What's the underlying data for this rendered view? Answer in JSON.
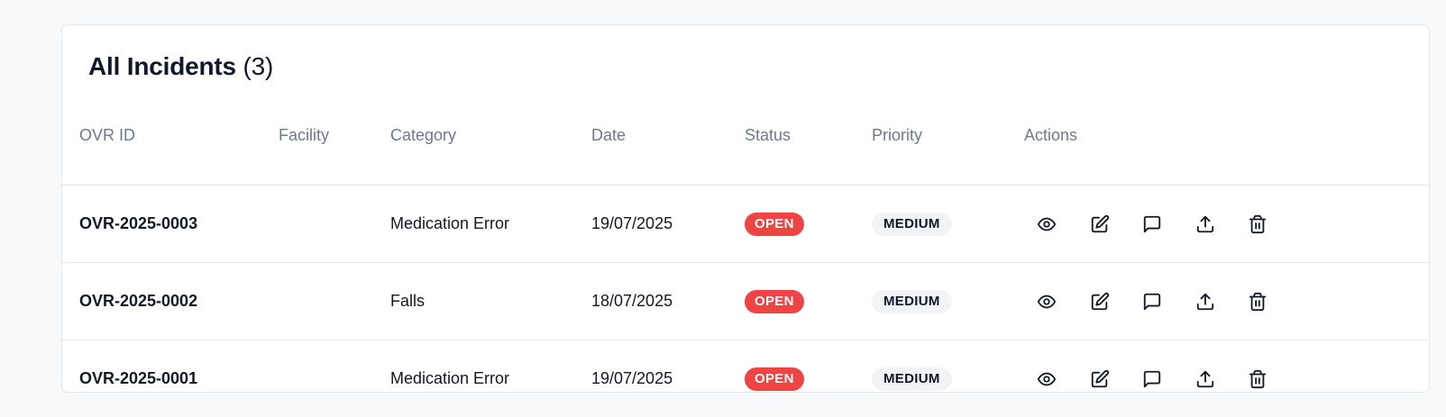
{
  "card": {
    "title": "All Incidents",
    "count": "(3)"
  },
  "columns": {
    "id": "OVR ID",
    "facility": "Facility",
    "category": "Category",
    "date": "Date",
    "status": "Status",
    "priority": "Priority",
    "actions": "Actions"
  },
  "rows": [
    {
      "id": "OVR-2025-0003",
      "facility": "",
      "category": "Medication Error",
      "date": "19/07/2025",
      "status": "OPEN",
      "priority": "MEDIUM"
    },
    {
      "id": "OVR-2025-0002",
      "facility": "",
      "category": "Falls",
      "date": "18/07/2025",
      "status": "OPEN",
      "priority": "MEDIUM"
    },
    {
      "id": "OVR-2025-0001",
      "facility": "",
      "category": "Medication Error",
      "date": "19/07/2025",
      "status": "OPEN",
      "priority": "MEDIUM"
    }
  ],
  "action_icons": [
    "eye-icon",
    "edit-icon",
    "comment-icon",
    "upload-icon",
    "trash-icon"
  ],
  "colors": {
    "status_open": "#ef4444",
    "priority_bg": "#f1f3f6",
    "header_text": "#6b7a90"
  }
}
